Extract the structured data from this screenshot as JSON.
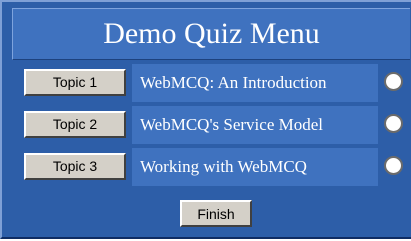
{
  "title": "Demo Quiz Menu",
  "colors": {
    "frame": "#2d5ea8",
    "cell": "#3f72bf",
    "button_face": "#d4d0c8",
    "text_light": "#ffffff"
  },
  "topics": [
    {
      "button_label": "Topic 1",
      "title": "WebMCQ: An Introduction",
      "selected": false
    },
    {
      "button_label": "Topic 2",
      "title": "WebMCQ's Service Model",
      "selected": false
    },
    {
      "button_label": "Topic 3",
      "title": "Working with WebMCQ",
      "selected": false
    }
  ],
  "finish_label": "Finish"
}
